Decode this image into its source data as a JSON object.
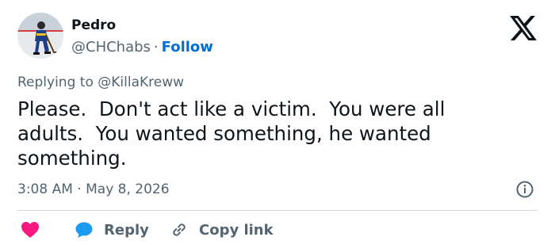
{
  "author": {
    "name": "Pedro",
    "handle": "@CHChabs",
    "separator": "·",
    "follow_label": "Follow"
  },
  "reply_context": {
    "prefix": "Replying to",
    "mention": "@KillaKreww"
  },
  "tweet": {
    "text": "Please.  Don't act like a victim.  You were all\nadults.  You wanted something, he wanted\nsomething."
  },
  "meta": {
    "time": "3:08 AM",
    "separator": "·",
    "date": "May 8, 2026"
  },
  "actions": {
    "reply_label": "Reply",
    "copy_link_label": "Copy link"
  },
  "icons": {
    "brand": "x-logo-icon",
    "info": "info-icon",
    "like": "heart-icon",
    "reply": "speech-bubble-icon",
    "copy": "link-icon"
  },
  "colors": {
    "text_primary": "#0f1419",
    "text_secondary": "#536471",
    "link_blue": "#006fd6",
    "heart_pink": "#f91880",
    "reply_blue": "#1d9bf0",
    "divider": "#cfd9de"
  }
}
